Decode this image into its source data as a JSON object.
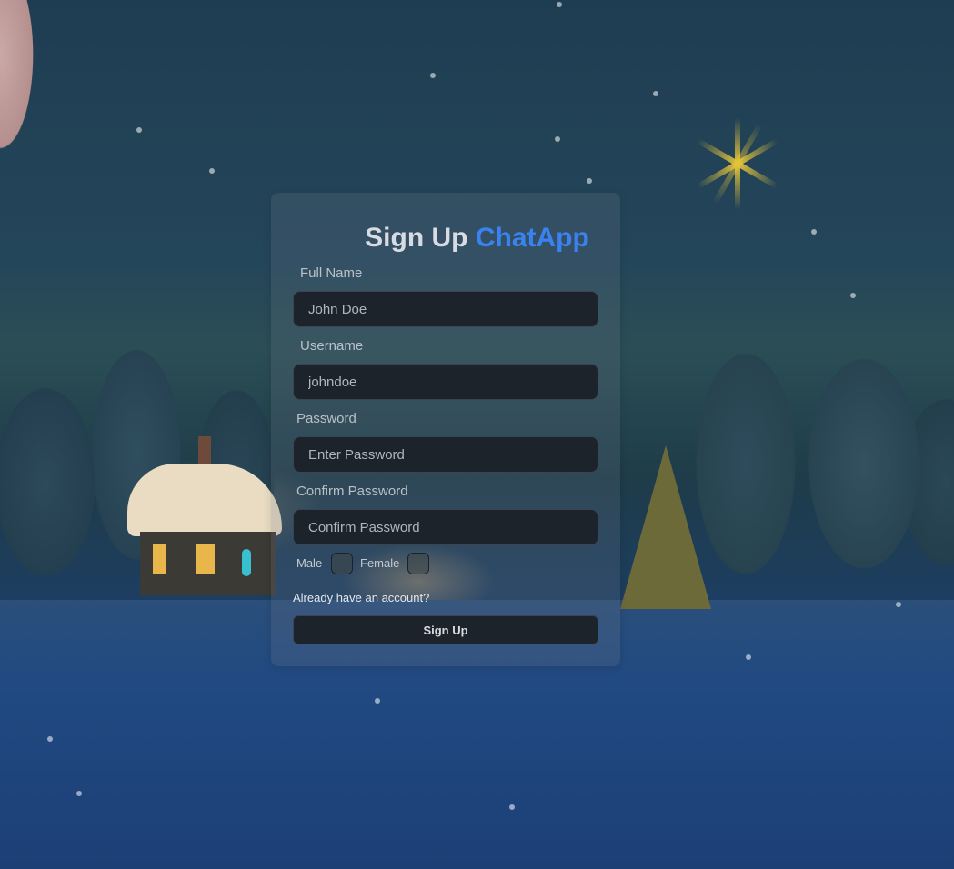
{
  "form": {
    "title_main": "Sign Up",
    "title_brand": "ChatApp",
    "full_name": {
      "label": "Full Name",
      "placeholder": "John Doe"
    },
    "username": {
      "label": "Username",
      "placeholder": "johndoe"
    },
    "password": {
      "label": "Password",
      "placeholder": "Enter Password"
    },
    "confirm_password": {
      "label": "Confirm Password",
      "placeholder": "Confirm Password"
    },
    "gender": {
      "male_label": "Male",
      "female_label": "Female",
      "male_checked": false,
      "female_checked": false
    },
    "login_link": "Already have an account?",
    "submit_label": "Sign Up"
  },
  "colors": {
    "brand_accent": "#3a82ef",
    "input_background": "#1d232a",
    "label_text": "#b9c0c8"
  },
  "background": {
    "scene": "snowy night with cottage, pine trees, christmas tree, star and moon"
  }
}
